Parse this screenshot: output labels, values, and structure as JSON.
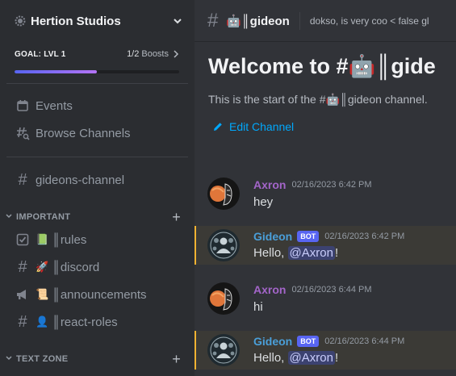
{
  "server": {
    "name": "Hertion Studios"
  },
  "boost": {
    "goal": "GOAL: LVL 1",
    "count": "1/2",
    "label": "Boosts",
    "progress": 0.5
  },
  "nav": {
    "events": "Events",
    "browse": "Browse Channels",
    "gideons_channel": "gideons-channel"
  },
  "categories": {
    "important": "IMPORTANT",
    "text_zone": "TEXT ZONE"
  },
  "channels": {
    "rules": {
      "emoji": "📗",
      "name": "║rules"
    },
    "discord": {
      "emoji": "🚀",
      "name": "║discord"
    },
    "announcements": {
      "emoji": "📜",
      "name": "║announcements"
    },
    "react_roles": {
      "emoji": "👤",
      "name": "║react-roles"
    }
  },
  "topbar": {
    "channel_emoji": "🤖",
    "channel_name": "║gideon",
    "topic": "dokso, is very coo < false gl"
  },
  "welcome": {
    "title_prefix": "Welcome to #",
    "title_emoji": "🤖",
    "title_suffix": "║gide",
    "start_prefix": "This is the start of the #",
    "start_emoji": "🤖",
    "start_suffix": "║gideon channel.",
    "edit": "Edit Channel"
  },
  "messages": [
    {
      "author": "Axron",
      "time": "02/16/2023 6:42 PM",
      "text": "hey"
    },
    {
      "author": "Gideon",
      "bot": "BOT",
      "time": "02/16/2023 6:42 PM",
      "prefix": "Hello, ",
      "mention": "@Axron",
      "suffix": "!"
    },
    {
      "author": "Axron",
      "time": "02/16/2023 6:44 PM",
      "text": "hi"
    },
    {
      "author": "Gideon",
      "bot": "BOT",
      "time": "02/16/2023 6:44 PM",
      "prefix": "Hello, ",
      "mention": "@Axron",
      "suffix": "!"
    }
  ],
  "colors": {
    "accent": "#5865f2",
    "link": "#00a8fc",
    "highlight": "#f0b232",
    "axron": "#a365c9",
    "gideon": "#4a9fd9"
  }
}
